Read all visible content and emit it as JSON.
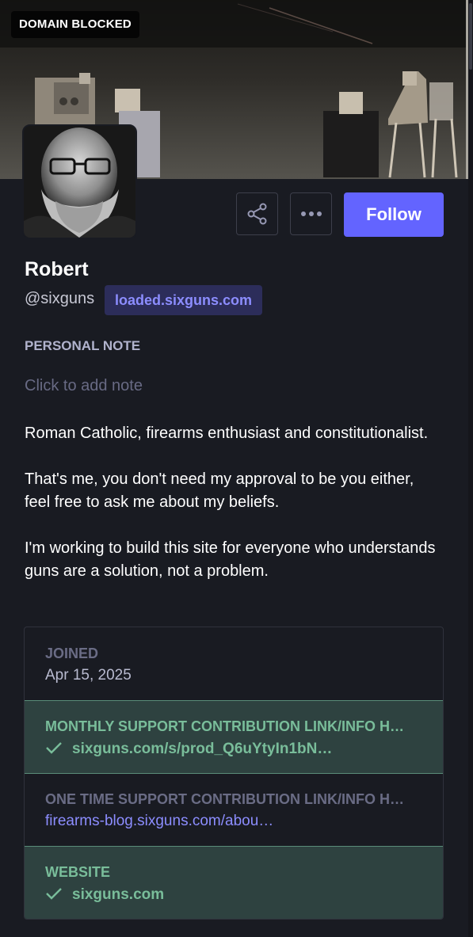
{
  "header": {
    "badge": "DOMAIN BLOCKED"
  },
  "profile": {
    "display_name": "Robert",
    "username": "@sixguns",
    "domain": "loaded.sixguns.com"
  },
  "actions": {
    "share_icon": "share-icon",
    "more_icon": "more-horizontal-icon",
    "follow_label": "Follow"
  },
  "note": {
    "label": "PERSONAL NOTE",
    "placeholder": "Click to add note"
  },
  "bio": [
    "Roman Catholic, firearms enthusiast and constitutionalist.",
    "That's me, you don't need my approval to be you either, feel free to ask me about my beliefs.",
    "I'm working to build this site for everyone who understands guns are a solution, not a problem."
  ],
  "fields": {
    "joined": {
      "label": "JOINED",
      "value": "Apr 15, 2025"
    },
    "monthly": {
      "label": "MONTHLY SUPPORT CONTRIBUTION LINK/INFO H…",
      "value": "sixguns.com/s/prod_Q6uYtyIn1bN…",
      "verified": true
    },
    "onetime": {
      "label": "ONE TIME SUPPORT CONTRIBUTION LINK/INFO H…",
      "value": "firearms-blog.sixguns.com/abou…",
      "verified": false
    },
    "website": {
      "label": "WEBSITE",
      "value": "sixguns.com",
      "verified": true
    }
  },
  "colors": {
    "accent": "#6364ff",
    "verified_green": "#79bd9a",
    "verified_bg": "#2e4240",
    "background": "#191b22"
  }
}
